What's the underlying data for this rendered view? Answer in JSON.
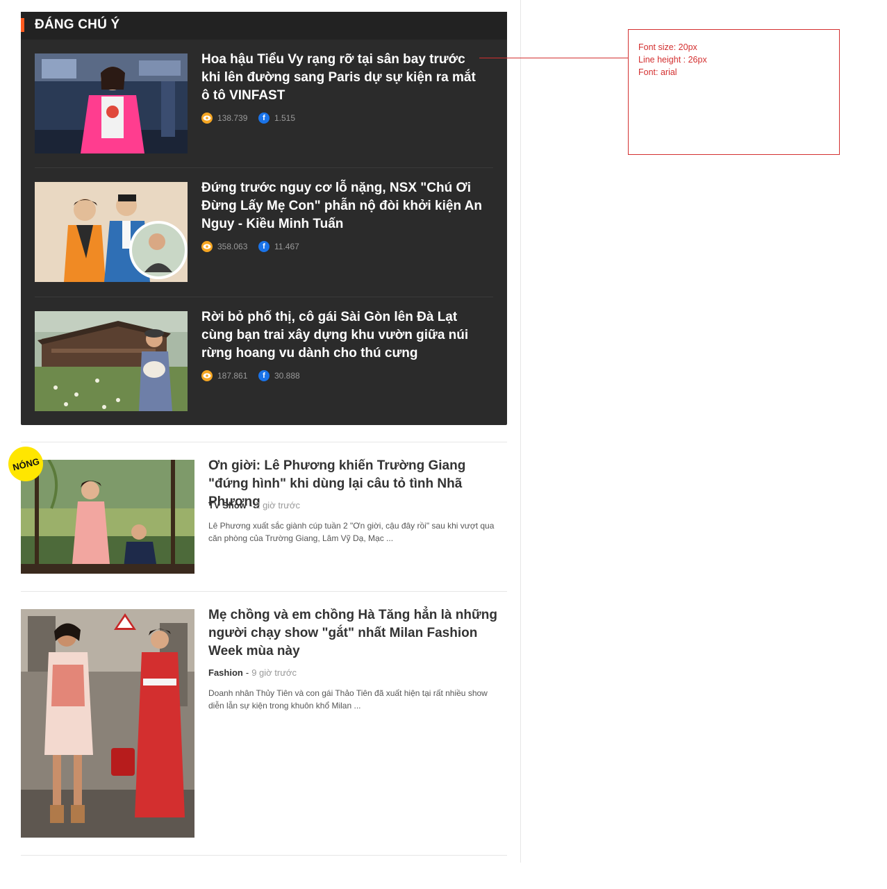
{
  "featured": {
    "title": "ĐÁNG CHÚ Ý",
    "items": [
      {
        "headline": "Hoa hậu Tiểu Vy rạng rỡ tại sân bay trước khi lên đường sang Paris dự sự kiện ra mắt ô tô VINFAST",
        "views": "138.739",
        "shares": "1.515"
      },
      {
        "headline": "Đứng trước nguy cơ lỗ nặng, NSX \"Chú Ơi Đừng Lấy Mẹ Con\" phẫn nộ đòi khởi kiện An Nguy - Kiều Minh Tuấn",
        "views": "358.063",
        "shares": "11.467"
      },
      {
        "headline": "Rời bỏ phố thị, cô gái Sài Gòn lên Đà Lạt cùng bạn trai xây dựng khu vườn giữa núi rừng hoang vu dành cho thú cưng",
        "views": "187.861",
        "shares": "30.888"
      }
    ]
  },
  "icons": {
    "views": "eye-icon",
    "shares": "facebook-icon",
    "facebook_glyph": "f"
  },
  "colors": {
    "accent": "#ff5a1f",
    "dark_bg": "#2b2b2b",
    "hot_badge": "#ffe600",
    "annotation": "#d32f2f"
  },
  "articles": [
    {
      "badge": "NÓNG",
      "headline": "Ơn giời: Lê Phương khiến Trường Giang \"đứng hình\" khi dùng lại câu tỏ tình Nhã Phương",
      "category": "TV Show",
      "time": "2 giờ trước",
      "summary": "Lê Phương xuất sắc giành cúp tuần 2 \"Ơn giời, cậu đây rồi\" sau khi vượt qua căn phòng của Trường Giang, Lâm Vỹ Dạ, Mạc ..."
    },
    {
      "headline": "Mẹ chồng và em chồng Hà Tăng hẳn là những người chạy show \"gắt\" nhất Milan Fashion Week mùa này",
      "category": "Fashion",
      "time": "9 giờ trước",
      "summary": "Doanh nhân Thủy Tiên và con gái Thảo Tiên đã xuất hiện tại rất nhiều show diễn lẫn sự kiện trong khuôn khổ Milan ..."
    }
  ],
  "annotation": {
    "font_size": "Font size: 20px",
    "line_height": "Line height : 26px",
    "font": "Font: arial"
  }
}
